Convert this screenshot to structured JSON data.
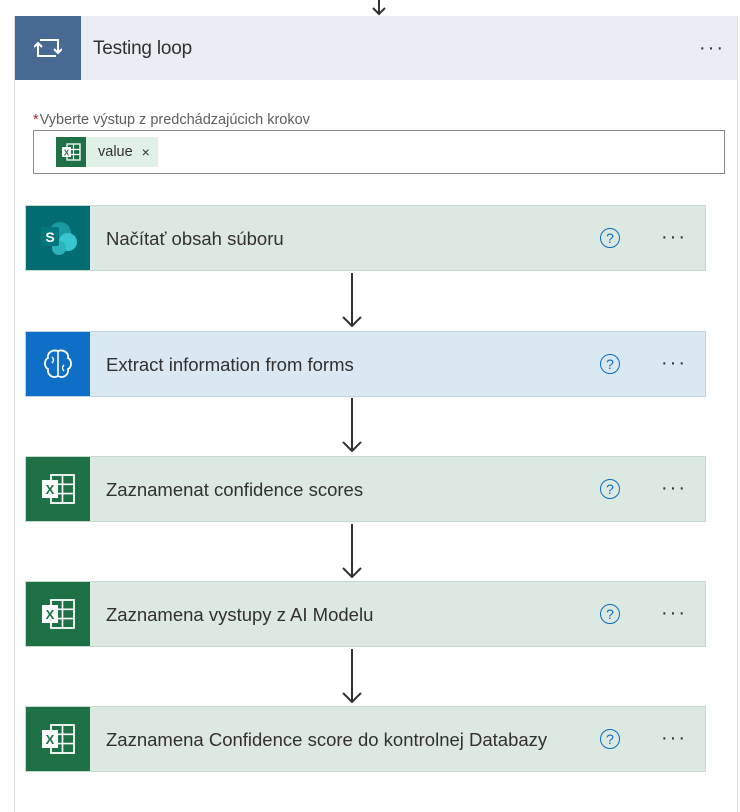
{
  "loop": {
    "title": "Testing loop",
    "more_label": "···",
    "field": {
      "required_mark": "*",
      "label": "Vyberte výstup z predchádzajúcich krokov",
      "token": {
        "label": "value",
        "remove": "×",
        "icon": "excel-icon"
      }
    }
  },
  "actions": [
    {
      "title": "Načítať obsah súboru",
      "icon": "sharepoint-icon",
      "help": "?",
      "more": "···"
    },
    {
      "title": "Extract information from forms",
      "icon": "ai-builder-brain-icon",
      "help": "?",
      "more": "···"
    },
    {
      "title": "Zaznamenat confidence scores",
      "icon": "excel-icon",
      "help": "?",
      "more": "···"
    },
    {
      "title": "Zaznamena vystupy z AI Modelu",
      "icon": "excel-icon",
      "help": "?",
      "more": "···"
    },
    {
      "title": "Zaznamena Confidence score do kontrolnej Databazy",
      "icon": "excel-icon",
      "help": "?",
      "more": "···"
    }
  ],
  "colors": {
    "loop_header": "#eaedf3",
    "loop_icon": "#486991",
    "sharepoint": "#036c70",
    "ai_builder": "#0f6fc6",
    "excel": "#1e7145",
    "action_green": "#dbe9e2",
    "action_blue": "#dae8f4",
    "help_blue": "#0f6cbd"
  }
}
